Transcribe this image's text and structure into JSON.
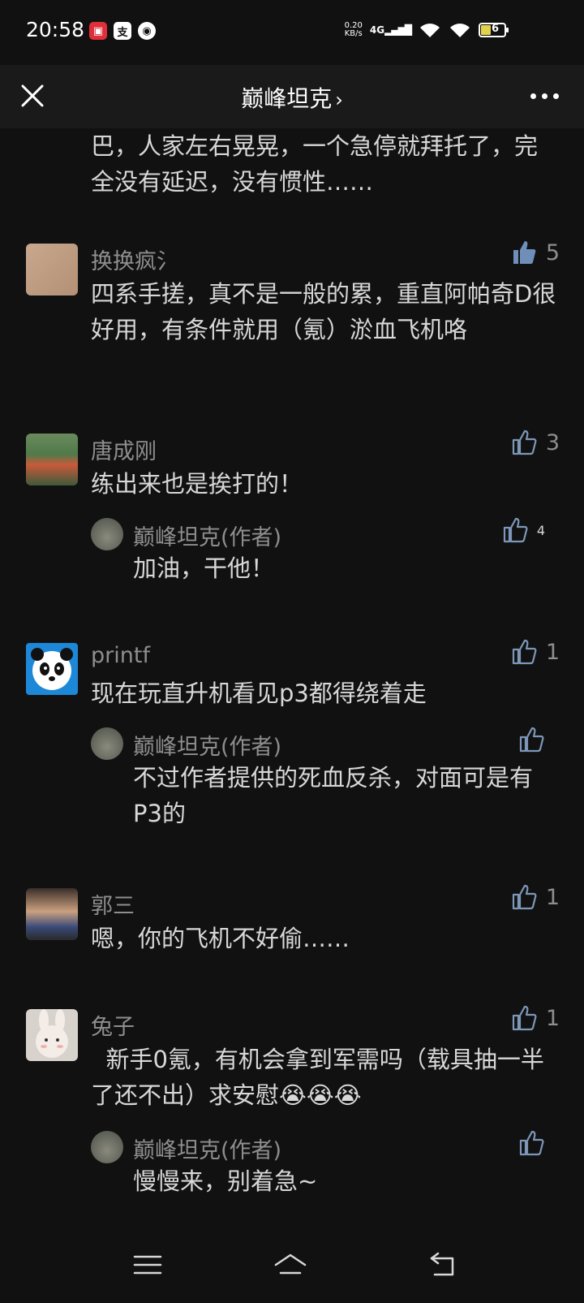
{
  "status": {
    "time": "20:58",
    "net_speed_value": "0.20",
    "net_speed_unit": "KB/s",
    "network": "4G",
    "battery": "6"
  },
  "header": {
    "title": "巅峰坦克",
    "chevron": "›"
  },
  "prev_comment_tail": "巴，人家左右晃晃，一个急停就拜托了，完全没有延迟，没有惯性……",
  "comments": [
    {
      "name": "换换疯氵",
      "text": "四系手搓，真不是一般的累，重直阿帕奇D很好用，有条件就用（氪）淤血飞机咯",
      "likes": "5",
      "liked": true
    },
    {
      "name": "唐成刚",
      "text": "练出来也是挨打的！",
      "likes": "3",
      "reply": {
        "name": "巅峰坦克(作者)",
        "text": "加油，干他！",
        "likes": "4"
      }
    },
    {
      "name": "printf",
      "text": "现在玩直升机看见p3都得绕着走",
      "likes": "1",
      "reply": {
        "name": "巅峰坦克(作者)",
        "text": "不过作者提供的死血反杀，对面可是有P3的",
        "likes": ""
      }
    },
    {
      "name": "郭三",
      "text": "嗯，你的飞机不好偷……",
      "likes": "1"
    },
    {
      "name": "兔子",
      "text": "  新手0氪，有机会拿到军需吗（载具抽一半了还不出）求安慰😭😭😭",
      "likes": "1",
      "reply": {
        "name": "巅峰坦克(作者)",
        "text": "慢慢来，别着急~",
        "likes": ""
      }
    }
  ],
  "colors": {
    "background": "#111111",
    "header": "#1a1a1a",
    "text": "#d8d8d8",
    "muted": "#8e8e8e",
    "like_active": "#6f8fb8",
    "like_outline": "#7d97b8"
  }
}
